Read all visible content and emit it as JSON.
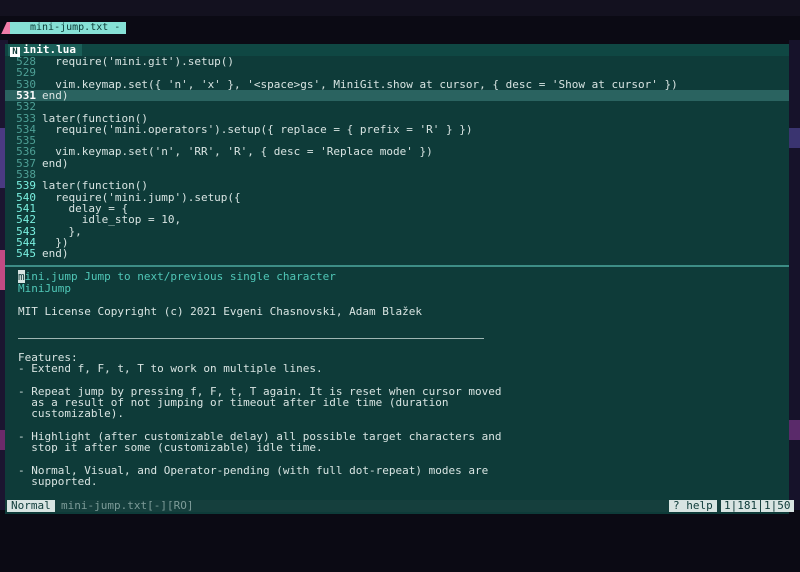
{
  "tabline": {
    "tab_label": "mini-jump.txt -"
  },
  "editor": {
    "file_tab": "init.lua",
    "lines": [
      {
        "n": "528",
        "t": "  require('mini.git').setup()"
      },
      {
        "n": "529",
        "t": ""
      },
      {
        "n": "530",
        "t": "  vim.keymap.set({ 'n', 'x' }, '<space>gs', MiniGit.show_at_cursor, { desc = 'Show at cursor' })"
      },
      {
        "n": "531",
        "t": "end)"
      },
      {
        "n": "532",
        "t": ""
      },
      {
        "n": "533",
        "t": "later(function()"
      },
      {
        "n": "534",
        "t": "  require('mini.operators').setup({ replace = { prefix = 'R' } })"
      },
      {
        "n": "535",
        "t": ""
      },
      {
        "n": "536",
        "t": "  vim.keymap.set('n', 'RR', 'R', { desc = 'Replace mode' })"
      },
      {
        "n": "537",
        "t": "end)"
      },
      {
        "n": "538",
        "t": ""
      },
      {
        "n": "539",
        "t": "later(function()"
      },
      {
        "n": "540",
        "t": "  require('mini.jump').setup({"
      },
      {
        "n": "541",
        "t": "    delay = {"
      },
      {
        "n": "542",
        "t": "      idle_stop = 10,"
      },
      {
        "n": "543",
        "t": "    },"
      },
      {
        "n": "544",
        "t": "  })"
      },
      {
        "n": "545",
        "t": "end)"
      }
    ]
  },
  "help": {
    "title_rest": "ini.jump Jump to next/previous single character",
    "title_tag_first": "m",
    "tag": "MiniJump",
    "license": "MIT License Copyright (c) 2021 Evgeni Chasnovski, Adam Blažek",
    "features_heading": "Features:",
    "bullets": [
      "- Extend f, F, t, T to work on multiple lines.",
      "",
      "- Repeat jump by pressing f, F, t, T again. It is reset when cursor moved",
      "  as a result of not jumping or timeout after idle time (duration",
      "  customizable).",
      "",
      "- Highlight (after customizable delay) all possible target characters and",
      "  stop it after some (customizable) idle time.",
      "",
      "- Normal, Visual, and Operator-pending (with full dot-repeat) modes are",
      "  supported."
    ]
  },
  "status": {
    "mode": "Normal",
    "filename": "mini-jump.txt[-][RO]",
    "help": "? help",
    "pos1": "1|181",
    "pos2": "1|50"
  }
}
